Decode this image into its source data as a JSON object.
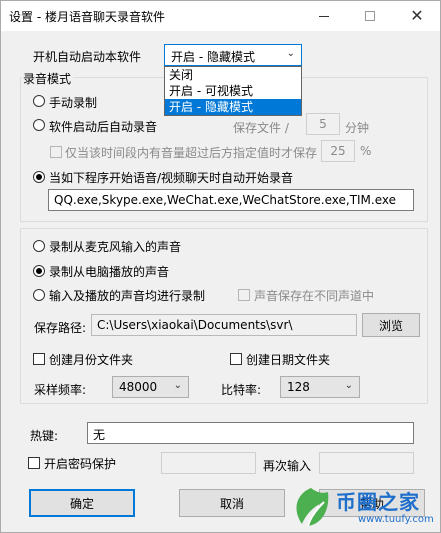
{
  "window": {
    "title": "设置 - 楼月语音聊天录音软件",
    "controls": {
      "minimize": "minimize-icon",
      "maximize": "maximize-icon",
      "close": "✕"
    }
  },
  "startup": {
    "label": "开机自动启动本软件",
    "selected": "开启 - 隐藏模式",
    "options": [
      "关闭",
      "开启 - 可视模式",
      "开启 - 隐藏模式"
    ],
    "selected_index": 2
  },
  "record_mode": {
    "group_label": "录音模式",
    "manual": "手动录制",
    "auto_after_start": "软件启动后自动录音",
    "save_every_label": "保存文件 /",
    "save_every_value": "5",
    "save_every_unit": "分钟",
    "volume_only_label": "仅当该时间段内有音量超过后方指定值时才保存",
    "volume_value": "25",
    "volume_unit": "%",
    "on_program_start": "当如下程序开始语音/视频聊天时自动开始录音",
    "programs": "QQ.exe,Skype.exe,WeChat.exe,WeChatStore.exe,TIM.exe",
    "selected": "on_program_start"
  },
  "source": {
    "from_mic": "录制从麦克风输入的声音",
    "from_speaker": "录制从电脑播放的声音",
    "both": "输入及播放的声音均进行录制",
    "separate_channels": "声音保存在不同声道中",
    "selected": "from_speaker",
    "save_path_label": "保存路径:",
    "save_path": "C:\\Users\\xiaokai\\Documents\\svr\\",
    "browse": "浏览",
    "month_folder": "创建月份文件夹",
    "date_folder": "创建日期文件夹",
    "sample_rate_label": "采样频率:",
    "sample_rate": "48000",
    "bitrate_label": "比特率:",
    "bitrate": "128"
  },
  "hotkey": {
    "label": "热键:",
    "value": "无"
  },
  "password": {
    "label": "开启密码保护",
    "repeat_label": "再次输入"
  },
  "buttons": {
    "ok": "确定",
    "cancel": "取消",
    "help": "帮助"
  },
  "watermark": {
    "text": "币圈之家",
    "url": "www.tuufy.com",
    "color": "#1e6ecb"
  }
}
